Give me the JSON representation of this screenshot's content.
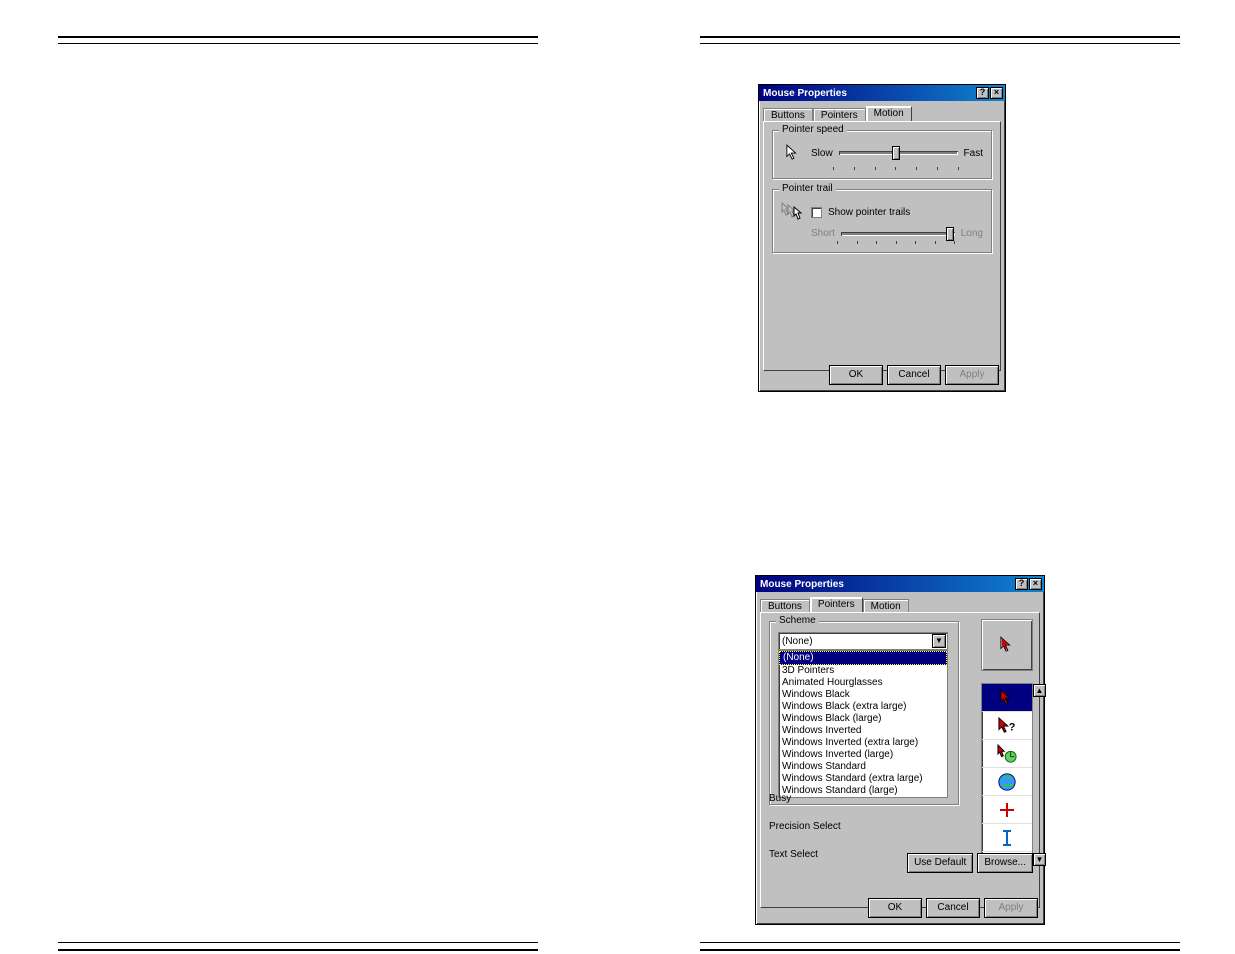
{
  "dlg1": {
    "title": "Mouse Properties",
    "tabs": [
      "Buttons",
      "Pointers",
      "Motion"
    ],
    "active_tab": 2,
    "pointer_speed": {
      "label": "Pointer speed",
      "slow": "Slow",
      "fast": "Fast"
    },
    "pointer_trail": {
      "label": "Pointer trail",
      "checkbox": "Show pointer trails",
      "short": "Short",
      "long": "Long"
    },
    "buttons": {
      "ok": "OK",
      "cancel": "Cancel",
      "apply": "Apply"
    }
  },
  "dlg2": {
    "title": "Mouse Properties",
    "tabs": [
      "Buttons",
      "Pointers",
      "Motion"
    ],
    "active_tab": 1,
    "scheme": {
      "label": "Scheme",
      "selected": "(None)",
      "options": [
        "(None)",
        "3D Pointers",
        "Animated Hourglasses",
        "Windows Black",
        "Windows Black (extra large)",
        "Windows Black (large)",
        "Windows Inverted",
        "Windows Inverted (extra large)",
        "Windows Inverted (large)",
        "Windows Standard",
        "Windows Standard (extra large)",
        "Windows Standard (large)"
      ]
    },
    "cursor_labels": [
      "Busy",
      "Precision Select",
      "Text Select"
    ],
    "use_default": "Use Default",
    "browse": "Browse...",
    "buttons": {
      "ok": "OK",
      "cancel": "Cancel",
      "apply": "Apply"
    }
  }
}
